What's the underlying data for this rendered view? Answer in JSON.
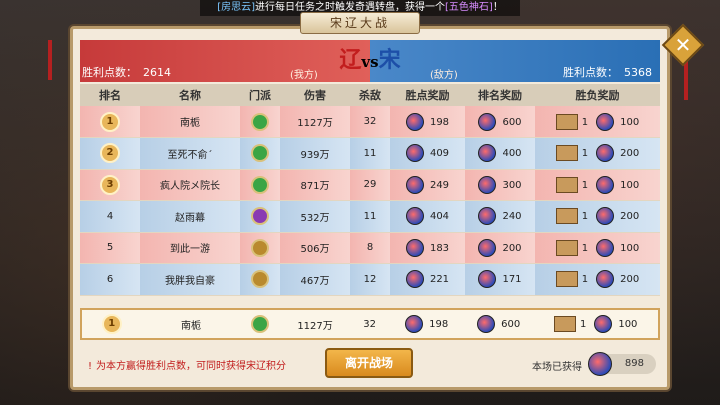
{
  "ticker": {
    "name": "[房思云]",
    "text": "进行每日任务之时触发奇遇转盘，获得一个",
    "item": "[五色神石]",
    "end": "！"
  },
  "window": {
    "title": "宋辽大战",
    "close_icon": "close-icon"
  },
  "vs": {
    "left_label": "胜利点数：",
    "left_score": "2614",
    "left_side": "(我方)",
    "right_label": "胜利点数：",
    "right_score": "5368",
    "right_side": "(敌方)",
    "liao": "辽",
    "vs": "vs",
    "song": "宋"
  },
  "table": {
    "headers": [
      "排名",
      "名称",
      "门派",
      "伤害",
      "杀敌",
      "胜点奖励",
      "排名奖励",
      "胜负奖励"
    ],
    "rows": [
      {
        "rank": "1",
        "name": "南栀",
        "faction": "green",
        "damage": "1127万",
        "kills": "32",
        "win_points": "198",
        "rank_reward": "600",
        "chest_count": "1",
        "win_reward": "100",
        "team": "red"
      },
      {
        "rank": "2",
        "name": "至死不俞ˊ",
        "faction": "green",
        "damage": "939万",
        "kills": "11",
        "win_points": "409",
        "rank_reward": "400",
        "chest_count": "1",
        "win_reward": "200",
        "team": "blue"
      },
      {
        "rank": "3",
        "name": "疯人院メ院长",
        "faction": "green",
        "damage": "871万",
        "kills": "29",
        "win_points": "249",
        "rank_reward": "300",
        "chest_count": "1",
        "win_reward": "100",
        "team": "red"
      },
      {
        "rank": "4",
        "name": "赵雨幕",
        "faction": "purple",
        "damage": "532万",
        "kills": "11",
        "win_points": "404",
        "rank_reward": "240",
        "chest_count": "1",
        "win_reward": "200",
        "team": "blue"
      },
      {
        "rank": "5",
        "name": "到此一游",
        "faction": "sword",
        "damage": "506万",
        "kills": "8",
        "win_points": "183",
        "rank_reward": "200",
        "chest_count": "1",
        "win_reward": "100",
        "team": "red"
      },
      {
        "rank": "6",
        "name": "我胖我自豪",
        "faction": "sword",
        "damage": "467万",
        "kills": "12",
        "win_points": "221",
        "rank_reward": "171",
        "chest_count": "1",
        "win_reward": "200",
        "team": "blue"
      }
    ],
    "self": {
      "rank": "1",
      "name": "南栀",
      "faction": "green",
      "damage": "1127万",
      "kills": "32",
      "win_points": "198",
      "rank_reward": "600",
      "chest_count": "1",
      "win_reward": "100"
    }
  },
  "footer": {
    "hint": "为本方赢得胜利点数，可同时获得宋辽积分",
    "leave_label": "离开战场",
    "earned_label": "本场已获得",
    "earned_value": "898"
  }
}
